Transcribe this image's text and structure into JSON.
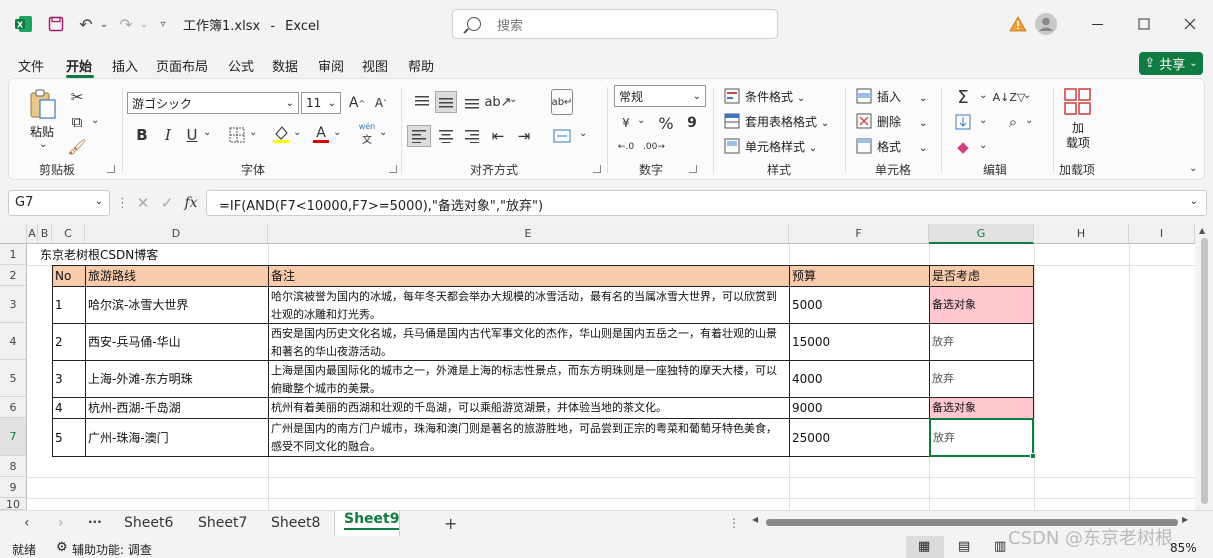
{
  "titlebar": {
    "filename": "工作簿1.xlsx",
    "separator": "-",
    "app": "Excel",
    "search_placeholder": "搜索"
  },
  "menu": [
    "文件",
    "开始",
    "插入",
    "页面布局",
    "公式",
    "数据",
    "审阅",
    "视图",
    "帮助"
  ],
  "share_label": "共享",
  "ribbon": {
    "clipboard": {
      "paste": "粘贴",
      "label": "剪贴板"
    },
    "font": {
      "name": "游ゴシック",
      "size": "11",
      "label": "字体",
      "bold": "B",
      "italic": "I",
      "underline": "U",
      "wen": "wén"
    },
    "alignment": {
      "label": "对齐方式"
    },
    "number": {
      "format": "常规",
      "label": "数字",
      "percent": "%",
      "comma": "9"
    },
    "styles": {
      "conditional": "条件格式",
      "table": "套用表格格式",
      "cell": "单元格样式",
      "label": "样式"
    },
    "cells": {
      "insert": "插入",
      "delete": "删除",
      "format": "格式",
      "label": "单元格"
    },
    "editing": {
      "label": "编辑"
    },
    "addins": {
      "item": "加\n载项",
      "label": "加载项"
    }
  },
  "formula": {
    "namebox": "G7",
    "formula": "=IF(AND(F7<10000,F7>=5000),\"备选对象\",\"放弃\")"
  },
  "columns": [
    "A",
    "B",
    "C",
    "D",
    "E",
    "F",
    "G",
    "H",
    "I"
  ],
  "rows": [
    "1",
    "2",
    "3",
    "4",
    "5",
    "6",
    "7",
    "8",
    "9",
    "10"
  ],
  "sheet": {
    "title": "东京老树根CSDN博客",
    "headers": [
      "No",
      "旅游路线",
      "备注",
      "预算",
      "是否考虑"
    ],
    "data": [
      [
        "1",
        "哈尔滨-冰雪大世界",
        "哈尔滨被誉为国内的冰城，每年冬天都会举办大规模的冰雪活动，最有名的当属冰雪大世界，可以欣赏到壮观的冰雕和灯光秀。",
        "5000",
        "备选对象"
      ],
      [
        "2",
        "西安-兵马俑-华山",
        "西安是国内历史文化名城，兵马俑是国内古代军事文化的杰作，华山则是国内五岳之一，有着壮观的山景和著名的华山夜游活动。",
        "15000",
        "放弃"
      ],
      [
        "3",
        "上海-外滩-东方明珠",
        "上海是国内最国际化的城市之一，外滩是上海的标志性景点，而东方明珠则是一座独特的摩天大楼，可以俯瞰整个城市的美景。",
        "4000",
        "放弃"
      ],
      [
        "4",
        "杭州-西湖-千岛湖",
        "杭州有着美丽的西湖和壮观的千岛湖，可以乘船游览湖景，并体验当地的茶文化。",
        "9000",
        "备选对象"
      ],
      [
        "5",
        "广州-珠海-澳门",
        "广州是国内的南方门户城市，珠海和澳门则是著名的旅游胜地，可品尝到正宗的粤菜和葡萄牙特色美食，感受不同文化的融合。",
        "25000",
        "放弃"
      ]
    ]
  },
  "sheets": [
    "Sheet6",
    "Sheet7",
    "Sheet8",
    "Sheet9"
  ],
  "ellipsis": "···",
  "status": {
    "ready": "就绪",
    "accessibility": "辅助功能: 调查",
    "zoom": "85%"
  },
  "watermark": "CSDN @东京老树根",
  "colors": {
    "accent": "#107c41",
    "header_fill": "#f8cbad",
    "highlight_fill": "#ffc7ce"
  }
}
